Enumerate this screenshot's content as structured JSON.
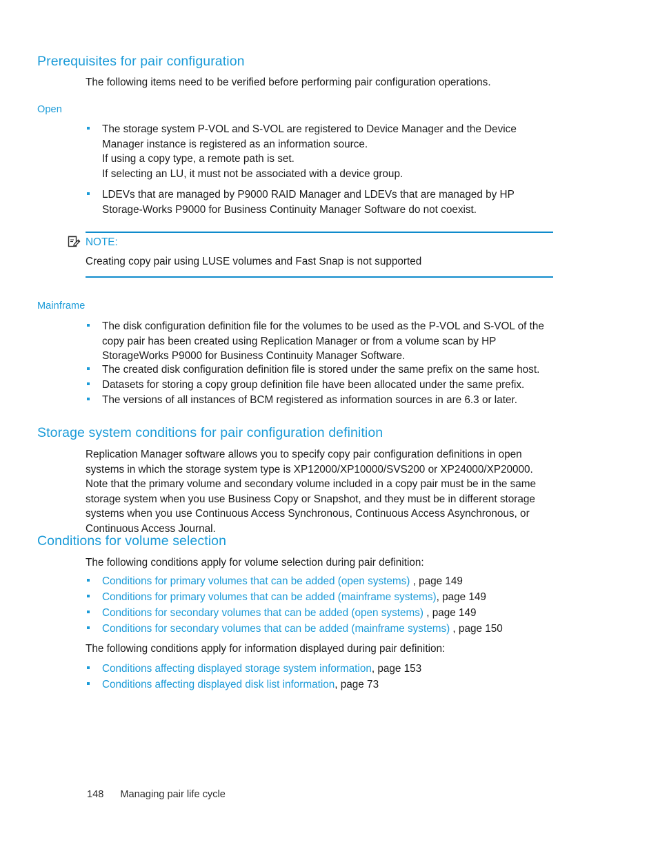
{
  "page": {
    "footer_page_number": "148",
    "footer_chapter": "Managing pair life cycle"
  },
  "colors": {
    "heading": "#1b9bd8",
    "link": "#1b9bd8",
    "bullet": "#1b9bd8",
    "rule": "#0f8bcc",
    "body_text": "#1a1a1a"
  },
  "sections": {
    "prerequisites": {
      "heading": "Prerequisites for pair configuration",
      "intro": "The following items need to be verified before performing pair configuration operations.",
      "open": {
        "heading": "Open",
        "bullet1": "The storage system P-VOL and S-VOL are registered to Device Manager and the Device Manager instance is registered as an information source.",
        "subline1": "If using a copy type, a remote path is set.",
        "subline2": "If selecting an LU, it must not be associated with a device group.",
        "bullet2": "LDEVs that are managed by P9000 RAID Manager and LDEVs that are managed by HP Storage-Works P9000 for Business Continuity Manager Software do not coexist."
      },
      "note": {
        "icon": "note-pad-pen-icon",
        "label": "NOTE:",
        "body": "Creating copy pair using LUSE volumes and Fast Snap is not supported"
      },
      "mainframe": {
        "heading": "Mainframe",
        "bullets": [
          "The disk configuration definition file for the volumes to be used as the P-VOL and S-VOL of the copy pair has been created using Replication Manager or from a volume scan by HP StorageWorks P9000 for Business Continuity Manager Software.",
          "The created disk configuration definition file is stored under the same prefix on the same host.",
          "Datasets for storing a copy group definition file have been allocated under the same prefix.",
          "The versions of all instances of BCM registered as information sources in are 6.3 or later."
        ]
      }
    },
    "storage_system_conditions": {
      "heading": "Storage system conditions for pair configuration definition",
      "body": "Replication Manager software allows you to specify copy pair configuration definitions in open systems in which the storage system type is XP12000/XP10000/SVS200 or XP24000/XP20000. Note that the primary volume and secondary volume included in a copy pair must be in the same storage system when you use Business Copy or Snapshot, and they must be in different storage systems when you use Continuous Access Synchronous, Continuous Access Asynchronous, or Continuous Access Journal."
    },
    "volume_selection": {
      "heading": "Conditions for volume selection",
      "intro1": "The following conditions apply for volume selection during pair definition:",
      "links1": [
        {
          "text": "Conditions for primary volumes that can be added (open systems)",
          "suffix": " , page 149"
        },
        {
          "text": "Conditions for primary volumes that can be added (mainframe systems)",
          "suffix": ", page 149"
        },
        {
          "text": "Conditions for secondary volumes that can be added (open systems)",
          "suffix": " , page 149"
        },
        {
          "text": "Conditions for secondary volumes that can be added (mainframe systems)",
          "suffix": " , page 150"
        }
      ],
      "intro2": "The following conditions apply for information displayed during pair definition:",
      "links2": [
        {
          "text": "Conditions affecting displayed storage system information",
          "suffix": ", page 153"
        },
        {
          "text": "Conditions affecting displayed disk list information",
          "suffix": ", page 73"
        }
      ]
    }
  }
}
